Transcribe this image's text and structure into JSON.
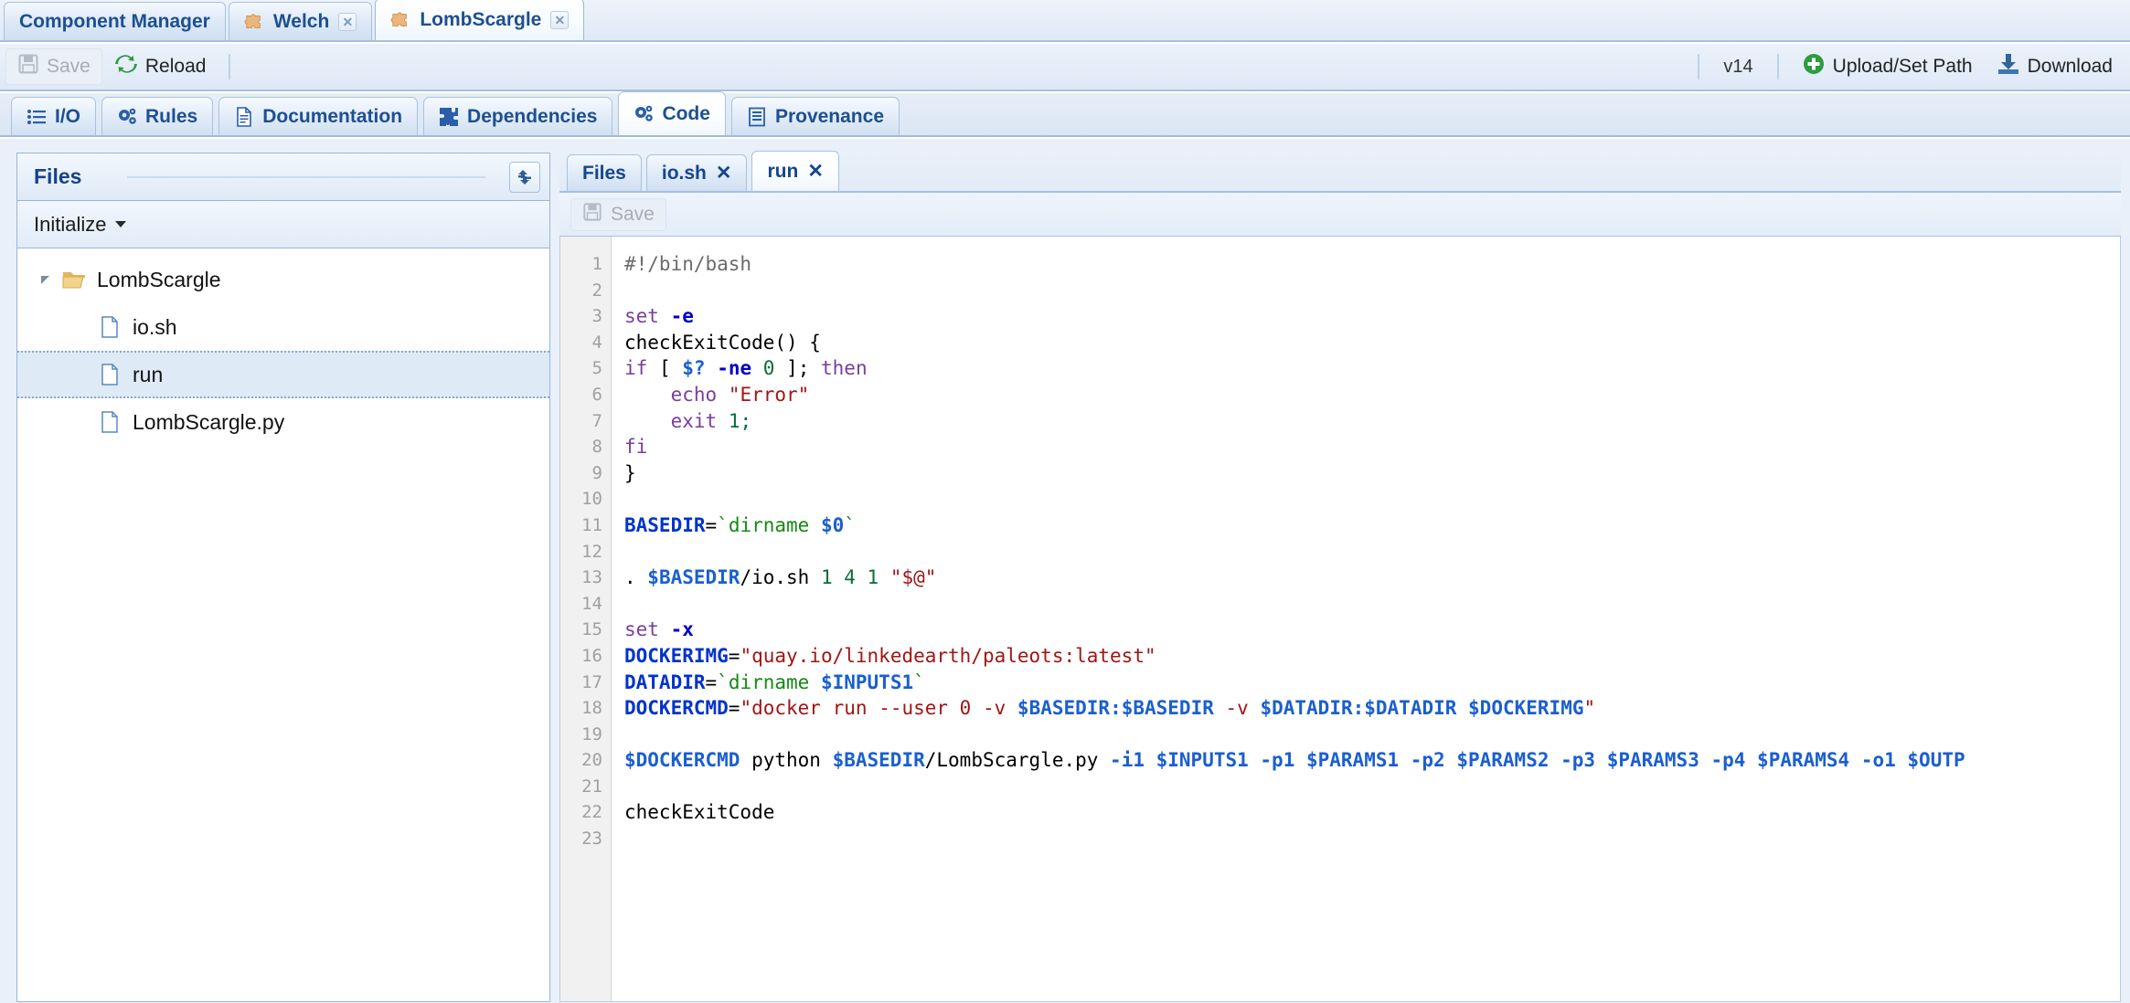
{
  "window_tabs": [
    {
      "label": "Component Manager",
      "icon": null,
      "closable": false,
      "active": false
    },
    {
      "label": "Welch",
      "icon": "puzzle-icon",
      "closable": true,
      "active": false
    },
    {
      "label": "LombScargle",
      "icon": "puzzle-icon",
      "closable": true,
      "active": true
    }
  ],
  "component_toolbar": {
    "save_label": "Save",
    "save_icon": "floppy-disk-icon",
    "save_disabled": true,
    "reload_label": "Reload",
    "reload_icon": "refresh-icon",
    "version_label": "v14",
    "upload_label": "Upload/Set Path",
    "upload_icon": "plus-circle-icon",
    "download_label": "Download",
    "download_icon": "download-icon"
  },
  "section_tabs": [
    {
      "label": "I/O",
      "icon": "list-icon",
      "active": false
    },
    {
      "label": "Rules",
      "icon": "gears-icon",
      "active": false
    },
    {
      "label": "Documentation",
      "icon": "document-icon",
      "active": false
    },
    {
      "label": "Dependencies",
      "icon": "puzzle-pieces-icon",
      "active": false
    },
    {
      "label": "Code",
      "icon": "gears-icon",
      "active": true
    },
    {
      "label": "Provenance",
      "icon": "records-icon",
      "active": false
    }
  ],
  "files_panel": {
    "title": "Files",
    "refresh_icon": "refresh-arrows-icon",
    "filter_label": "Initialize",
    "filter_caret_icon": "caret-down-icon",
    "tree": [
      {
        "label": "LombScargle",
        "icon": "folder-open-icon",
        "depth": 0,
        "expanded": true,
        "selected": false
      },
      {
        "label": "io.sh",
        "icon": "file-icon",
        "depth": 1,
        "expanded": false,
        "selected": false
      },
      {
        "label": "run",
        "icon": "file-icon",
        "depth": 1,
        "expanded": false,
        "selected": true
      },
      {
        "label": "LombScargle.py",
        "icon": "file-icon",
        "depth": 1,
        "expanded": false,
        "selected": false
      }
    ]
  },
  "editor": {
    "tabs": [
      {
        "label": "Files",
        "closable": false,
        "active": false
      },
      {
        "label": "io.sh",
        "closable": true,
        "active": false
      },
      {
        "label": "run",
        "closable": true,
        "active": true
      }
    ],
    "save_label": "Save",
    "save_icon": "floppy-disk-icon",
    "save_disabled": true,
    "line_numbers": [
      1,
      2,
      3,
      4,
      5,
      6,
      7,
      8,
      9,
      10,
      11,
      12,
      13,
      14,
      15,
      16,
      17,
      18,
      19,
      20,
      21,
      22,
      23
    ],
    "language": "bash",
    "lines": [
      [
        {
          "t": "#!/bin/bash",
          "c": "cmt"
        }
      ],
      [],
      [
        {
          "t": "set",
          "c": "kw"
        },
        {
          "t": " ",
          "c": "def"
        },
        {
          "t": "-e",
          "c": "opt"
        }
      ],
      [
        {
          "t": "checkExitCode() {",
          "c": "def"
        }
      ],
      [
        {
          "t": "if",
          "c": "kw"
        },
        {
          "t": " [ ",
          "c": "def"
        },
        {
          "t": "$?",
          "c": "var"
        },
        {
          "t": " ",
          "c": "def"
        },
        {
          "t": "-ne",
          "c": "opt"
        },
        {
          "t": " ",
          "c": "def"
        },
        {
          "t": "0",
          "c": "num"
        },
        {
          "t": " ]; ",
          "c": "def"
        },
        {
          "t": "then",
          "c": "kw"
        }
      ],
      [
        {
          "t": "    ",
          "c": "def"
        },
        {
          "t": "echo",
          "c": "kw"
        },
        {
          "t": " ",
          "c": "def"
        },
        {
          "t": "\"Error\"",
          "c": "str"
        }
      ],
      [
        {
          "t": "    ",
          "c": "def"
        },
        {
          "t": "exit",
          "c": "kw"
        },
        {
          "t": " ",
          "c": "def"
        },
        {
          "t": "1;",
          "c": "num"
        }
      ],
      [
        {
          "t": "fi",
          "c": "kw"
        }
      ],
      [
        {
          "t": "}",
          "c": "def"
        }
      ],
      [],
      [
        {
          "t": "BASEDIR",
          "c": "varb"
        },
        {
          "t": "=",
          "c": "def"
        },
        {
          "t": "`dirname ",
          "c": "grn"
        },
        {
          "t": "$0",
          "c": "var"
        },
        {
          "t": "`",
          "c": "grn"
        }
      ],
      [],
      [
        {
          "t": ". ",
          "c": "def"
        },
        {
          "t": "$BASEDIR",
          "c": "var"
        },
        {
          "t": "/io.sh ",
          "c": "def"
        },
        {
          "t": "1 4 1",
          "c": "num"
        },
        {
          "t": " ",
          "c": "def"
        },
        {
          "t": "\"$@\"",
          "c": "str"
        }
      ],
      [],
      [
        {
          "t": "set",
          "c": "kw"
        },
        {
          "t": " ",
          "c": "def"
        },
        {
          "t": "-x",
          "c": "opt"
        }
      ],
      [
        {
          "t": "DOCKERIMG",
          "c": "varb"
        },
        {
          "t": "=",
          "c": "def"
        },
        {
          "t": "\"quay.io/linkedearth/paleots:latest\"",
          "c": "str"
        }
      ],
      [
        {
          "t": "DATADIR",
          "c": "varb"
        },
        {
          "t": "=",
          "c": "def"
        },
        {
          "t": "`dirname ",
          "c": "grn"
        },
        {
          "t": "$INPUTS1",
          "c": "var"
        },
        {
          "t": "`",
          "c": "grn"
        }
      ],
      [
        {
          "t": "DOCKERCMD",
          "c": "varb"
        },
        {
          "t": "=",
          "c": "def"
        },
        {
          "t": "\"docker run ",
          "c": "str"
        },
        {
          "t": "--user",
          "c": "str"
        },
        {
          "t": " 0 ",
          "c": "str"
        },
        {
          "t": "-v",
          "c": "str"
        },
        {
          "t": " ",
          "c": "str"
        },
        {
          "t": "$BASEDIR:$BASEDIR",
          "c": "var"
        },
        {
          "t": " ",
          "c": "str"
        },
        {
          "t": "-v",
          "c": "str"
        },
        {
          "t": " ",
          "c": "str"
        },
        {
          "t": "$DATADIR:$DATADIR $DOCKERIMG",
          "c": "var"
        },
        {
          "t": "\"",
          "c": "str"
        }
      ],
      [],
      [
        {
          "t": "$DOCKERCMD",
          "c": "var"
        },
        {
          "t": " python ",
          "c": "def"
        },
        {
          "t": "$BASEDIR",
          "c": "var"
        },
        {
          "t": "/LombScargle.py ",
          "c": "def"
        },
        {
          "t": "-i1 $INPUTS1 -p1 $PARAMS1 -p2 $PARAMS2 -p3 $PARAMS3 -p4 $PARAMS4 -o1 $OUTP",
          "c": "var"
        }
      ],
      [],
      [
        {
          "t": "checkExitCode",
          "c": "def"
        }
      ],
      []
    ]
  }
}
